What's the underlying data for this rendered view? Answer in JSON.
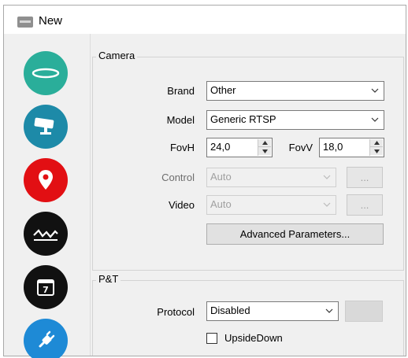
{
  "window": {
    "title": "New"
  },
  "sidebar": {
    "items": [
      {
        "icon": "ring-icon",
        "color": "#2aae9a"
      },
      {
        "icon": "camera-icon",
        "color": "#1d8aa8"
      },
      {
        "icon": "map-pin-icon",
        "color": "#e20f13"
      },
      {
        "icon": "terrain-icon",
        "color": "#111111"
      },
      {
        "icon": "calendar-icon",
        "color": "#111111"
      },
      {
        "icon": "plug-icon",
        "color": "#1e8ad6"
      }
    ]
  },
  "camera": {
    "group_title": "Camera",
    "brand_label": "Brand",
    "brand_value": "Other",
    "model_label": "Model",
    "model_value": "Generic RTSP",
    "fovh_label": "FovH",
    "fovh_value": "24,0",
    "fovv_label": "FovV",
    "fovv_value": "18,0",
    "control_label": "Control",
    "control_value": "Auto",
    "control_browse": "...",
    "video_label": "Video",
    "video_value": "Auto",
    "video_browse": "...",
    "advanced_button": "Advanced Parameters..."
  },
  "pt": {
    "group_title": "P&T",
    "protocol_label": "Protocol",
    "protocol_value": "Disabled",
    "protocol_browse": "...",
    "upsidedown_label": "UpsideDown",
    "upsidedown_checked": false
  }
}
